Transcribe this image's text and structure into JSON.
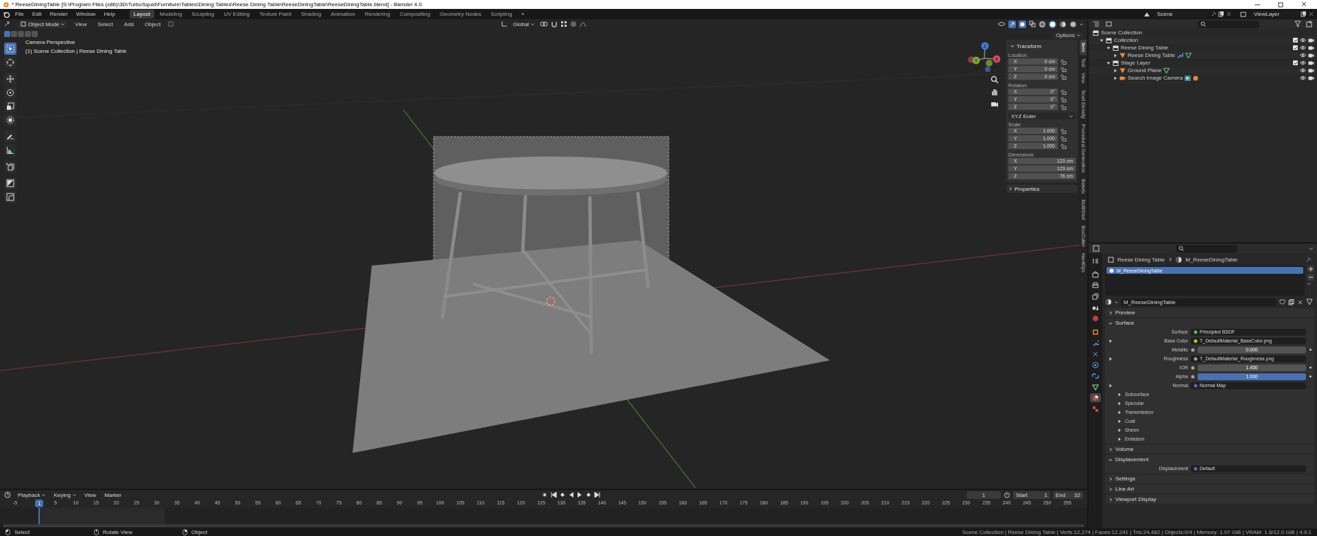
{
  "title_bar": {
    "title": "* ReeseDiningTable [S:\\Program Files (x86)\\3D\\TurboSquid\\Furniture\\Tables\\Dining Tables\\Reese Dining Table\\ReeseDiningTable\\ReeseDiningTable.blend] - Blender 4.0"
  },
  "menu": [
    "File",
    "Edit",
    "Render",
    "Window",
    "Help"
  ],
  "workspaces": [
    {
      "label": "Layout",
      "selected": true
    },
    {
      "label": "Modeling",
      "selected": false
    },
    {
      "label": "Sculpting",
      "selected": false
    },
    {
      "label": "UV Editing",
      "selected": false
    },
    {
      "label": "Texture Paint",
      "selected": false
    },
    {
      "label": "Shading",
      "selected": false
    },
    {
      "label": "Animation",
      "selected": false
    },
    {
      "label": "Rendering",
      "selected": false
    },
    {
      "label": "Compositing",
      "selected": false
    },
    {
      "label": "Geometry Nodes",
      "selected": false
    },
    {
      "label": "Scripting",
      "selected": false
    }
  ],
  "add_workspace": "+",
  "scene": "Scene",
  "view_layer": "ViewLayer",
  "viewport": {
    "mode": "Object Mode",
    "menus": [
      "View",
      "Select",
      "Add",
      "Object"
    ],
    "orientation": "Global",
    "options": "Options",
    "info": [
      "Camera Perspective",
      "(1) Scene Collection | Reese Dining Table"
    ],
    "gizmo_axes": [
      "X",
      "Y",
      "Z"
    ],
    "select_modes": [
      {
        "selected": true
      },
      {
        "selected": false
      },
      {
        "selected": false
      },
      {
        "selected": false
      },
      {
        "selected": false
      }
    ],
    "shading_modes": [
      {
        "kind": "wireframe",
        "selected": false
      },
      {
        "kind": "solid",
        "selected": true
      },
      {
        "kind": "material",
        "selected": false
      },
      {
        "kind": "rendered",
        "selected": false
      }
    ],
    "tools": [
      {
        "kind": "select",
        "selected": true
      },
      {
        "kind": "cursor",
        "selected": false
      },
      {
        "kind": "move",
        "selected": false
      },
      {
        "kind": "rotate",
        "selected": false
      },
      {
        "kind": "scale",
        "selected": false
      },
      {
        "kind": "transform",
        "selected": false
      },
      {
        "kind": "annotate",
        "selected": false
      },
      {
        "kind": "measure",
        "selected": false
      },
      {
        "kind": "add_cube",
        "selected": false
      },
      {
        "kind": "square",
        "selected": false
      },
      {
        "kind": "corner",
        "selected": false
      }
    ]
  },
  "sidebar": {
    "title": "Transform",
    "expanded": true,
    "sections": [
      {
        "kind": "lockable",
        "label": "Location:",
        "rows": [
          {
            "axis": "X",
            "value": "0 cm"
          },
          {
            "axis": "Y",
            "value": "0 cm"
          },
          {
            "axis": "Z",
            "value": "0 cm"
          }
        ]
      },
      {
        "kind": "lockable",
        "label": "Rotation:",
        "rows": [
          {
            "axis": "X",
            "value": "0°"
          },
          {
            "axis": "Y",
            "value": "0°"
          },
          {
            "axis": "Z",
            "value": "0°"
          }
        ]
      },
      {
        "kind": "dropdown",
        "value": "XYZ Euler"
      },
      {
        "kind": "lockable",
        "label": "Scale:",
        "rows": [
          {
            "axis": "X",
            "value": "1.000"
          },
          {
            "axis": "Y",
            "value": "1.000"
          },
          {
            "axis": "Z",
            "value": "1.000"
          }
        ]
      },
      {
        "kind": "plain",
        "label": "Dimensions:",
        "rows": [
          {
            "axis": "X",
            "value": "123 cm"
          },
          {
            "axis": "Y",
            "value": "123 cm"
          },
          {
            "axis": "Z",
            "value": "76 cm"
          }
        ]
      }
    ],
    "properties_panel": {
      "label": "Properties",
      "expanded": false
    },
    "tabs": [
      {
        "label": "Item",
        "selected": true
      },
      {
        "label": "Tool",
        "selected": false
      },
      {
        "label": "View",
        "selected": false
      },
      {
        "label": "Texel Density",
        "selected": false
      },
      {
        "label": "Procedural Generation",
        "selected": false
      },
      {
        "label": "Baketx",
        "selected": false
      },
      {
        "label": "MultiShot",
        "selected": false
      },
      {
        "label": "BoxCutter",
        "selected": false
      },
      {
        "label": "HardOps",
        "selected": false
      }
    ]
  },
  "outliner": {
    "rows": [
      {
        "name": "Scene Collection",
        "kind": "scene",
        "children": [
          {
            "name": "Collection",
            "kind": "collection",
            "checked": true,
            "expanded": true,
            "children": [
              {
                "name": "Reese Dining Table",
                "kind": "collection",
                "checked": true,
                "expanded": true,
                "children": [
                  {
                    "name": "Reese Dining Table",
                    "kind": "mesh",
                    "expanded": false,
                    "extras": [
                      {
                        "kind": "modifier"
                      },
                      {
                        "kind": "mesh_data"
                      }
                    ]
                  }
                ]
              },
              {
                "name": "Stage Layer",
                "kind": "collection",
                "checked": true,
                "expanded": true,
                "children": [
                  {
                    "name": "Ground Plane",
                    "kind": "mesh",
                    "expanded": false,
                    "extras": [
                      {
                        "kind": "mesh_data"
                      }
                    ]
                  },
                  {
                    "name": "Search Image Camera",
                    "kind": "camera",
                    "expanded": false,
                    "extras": [
                      {
                        "kind": "camera_data"
                      },
                      {
                        "kind": "material"
                      }
                    ]
                  }
                ]
              }
            ]
          }
        ]
      }
    ]
  },
  "properties": {
    "tabs": [
      {
        "kind": "tool",
        "selected": false
      },
      {
        "kind": "render",
        "selected": false
      },
      {
        "kind": "output",
        "selected": false
      },
      {
        "kind": "view_layer",
        "selected": false
      },
      {
        "kind": "scene",
        "selected": false
      },
      {
        "kind": "world",
        "selected": false
      },
      {
        "kind": "object",
        "selected": false
      },
      {
        "kind": "modifier",
        "selected": false
      },
      {
        "kind": "particles",
        "selected": false
      },
      {
        "kind": "physics",
        "selected": false
      },
      {
        "kind": "constraints",
        "selected": false
      },
      {
        "kind": "data",
        "selected": false
      },
      {
        "kind": "material",
        "selected": true
      },
      {
        "kind": "texture",
        "selected": false
      }
    ],
    "breadcrumb": [
      "Reese Dining Table",
      "M_ReeseDiningTable"
    ],
    "slots": [
      {
        "name": "M_ReeseDiningTable",
        "selected": true
      }
    ],
    "material": "M_ReeseDiningTable",
    "panels": [
      {
        "label": "Preview",
        "expanded": false
      },
      {
        "label": "Surface",
        "expanded": true,
        "inputs": [
          {
            "kind": "link",
            "label": "Surface",
            "value": "Principled BSDF",
            "color": "#52c452",
            "expandable": false
          },
          {
            "kind": "link",
            "label": "Base Color",
            "value": "T_DefaultMaterial_BaseColor.png",
            "color": "#c7c729",
            "expandable": true
          },
          {
            "kind": "slider",
            "label": "Metallic",
            "value": "0.000",
            "color": "#a1a1a1",
            "level": 0
          },
          {
            "kind": "link",
            "label": "Roughness",
            "value": "T_DefaultMaterial_Roughness.png",
            "color": "#a1a1a1",
            "expandable": true
          },
          {
            "kind": "slider",
            "label": "IOR",
            "value": "1.450",
            "color": "#a1a1a1",
            "level": 0
          },
          {
            "kind": "slider",
            "label": "Alpha",
            "value": "1.000",
            "color": "#a1a1a1",
            "level": 1
          },
          {
            "kind": "link",
            "label": "Normal",
            "value": "Normal Map",
            "color": "#6363c7",
            "expandable": true
          }
        ],
        "subpanels": [
          {
            "label": "Subsurface",
            "expanded": false
          },
          {
            "label": "Specular",
            "expanded": false
          },
          {
            "label": "Transmission",
            "expanded": false
          },
          {
            "label": "Coat",
            "expanded": false
          },
          {
            "label": "Sheen",
            "expanded": false
          },
          {
            "label": "Emission",
            "expanded": false
          }
        ]
      },
      {
        "label": "Volume",
        "expanded": false
      },
      {
        "label": "Displacement",
        "expanded": true,
        "inputs": [
          {
            "kind": "link",
            "label": "Displacement",
            "value": "Default",
            "color": "#6363c7",
            "expandable": false
          }
        ]
      },
      {
        "label": "Settings",
        "expanded": false
      },
      {
        "label": "Line Art",
        "expanded": false
      },
      {
        "label": "Viewport Display",
        "expanded": false
      }
    ]
  },
  "timeline": {
    "menus": [
      "Playback",
      "Keying",
      "View",
      "Marker"
    ],
    "current_frame": "1",
    "start": {
      "label": "Start",
      "value": "1"
    },
    "end": {
      "label": "End",
      "value": "32"
    },
    "playhead": "1",
    "ruler": [
      "-5",
      "5",
      "10",
      "15",
      "20",
      "25",
      "30",
      "35",
      "40",
      "45",
      "50",
      "55",
      "60",
      "65",
      "70",
      "75",
      "80",
      "85",
      "90",
      "95",
      "100",
      "105",
      "110",
      "115",
      "120",
      "125",
      "130",
      "135",
      "140",
      "145",
      "150",
      "155",
      "160",
      "165",
      "170",
      "175",
      "180",
      "185",
      "190",
      "195",
      "200",
      "205",
      "210",
      "215",
      "220",
      "225",
      "230",
      "235",
      "240",
      "245",
      "250",
      "255"
    ]
  },
  "status_bar": {
    "hints": [
      "Select",
      "Rotate View",
      "Object"
    ],
    "stats": "Scene Collection | Reese Dining Table | Verts:12,274 | Faces:12,241 | Tris:24,482 | Objects:0/4 | Memory: 1.07 GiB | VRAM: 1.6/12.0 GiB | 4.0.1"
  }
}
